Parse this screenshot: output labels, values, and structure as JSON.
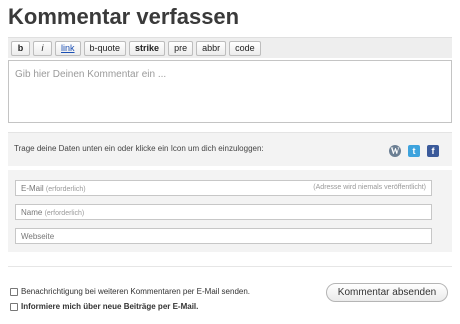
{
  "title": "Kommentar verfassen",
  "toolbar": {
    "buttons": [
      "b",
      "i",
      "link",
      "b-quote",
      "strike",
      "pre",
      "abbr",
      "code"
    ]
  },
  "comment": {
    "placeholder": "Gib hier Deinen Kommentar ein ..."
  },
  "login": {
    "text": "Trage deine Daten unten ein oder klicke ein Icon um dich einzuloggen:",
    "icons": [
      "wordpress-icon",
      "twitter-icon",
      "facebook-icon"
    ]
  },
  "fields": {
    "email_label": "E-Mail",
    "email_required": "(erforderlich)",
    "email_note": "(Adresse wird niemals veröffentlicht)",
    "name_label": "Name",
    "name_required": "(erforderlich)",
    "website_label": "Webseite"
  },
  "options": {
    "notify_comments": "Benachrichtigung bei weiteren Kommentaren per E-Mail senden.",
    "notify_posts": "Informiere mich über neue Beiträge per E-Mail."
  },
  "submit_label": "Kommentar absenden",
  "colors": {
    "wordpress": "#6c7f93",
    "twitter": "#3ea3dd",
    "facebook": "#3b5a9a"
  }
}
